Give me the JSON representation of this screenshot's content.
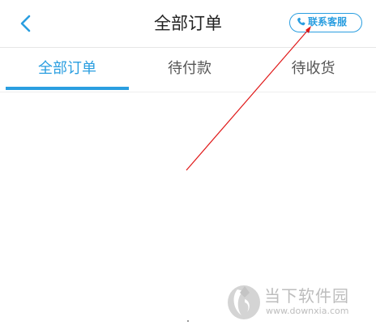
{
  "header": {
    "title": "全部订单",
    "support_label": "联系客服"
  },
  "tabs": [
    {
      "label": "全部订单",
      "active": true
    },
    {
      "label": "待付款",
      "active": false
    },
    {
      "label": "待收货",
      "active": false
    }
  ],
  "watermark": {
    "name": "当下软件园",
    "url": "www.downxia.com"
  },
  "colors": {
    "accent": "#2a9ee0",
    "annotation": "#e01818",
    "text": "#222222",
    "tab_inactive": "#555555"
  }
}
